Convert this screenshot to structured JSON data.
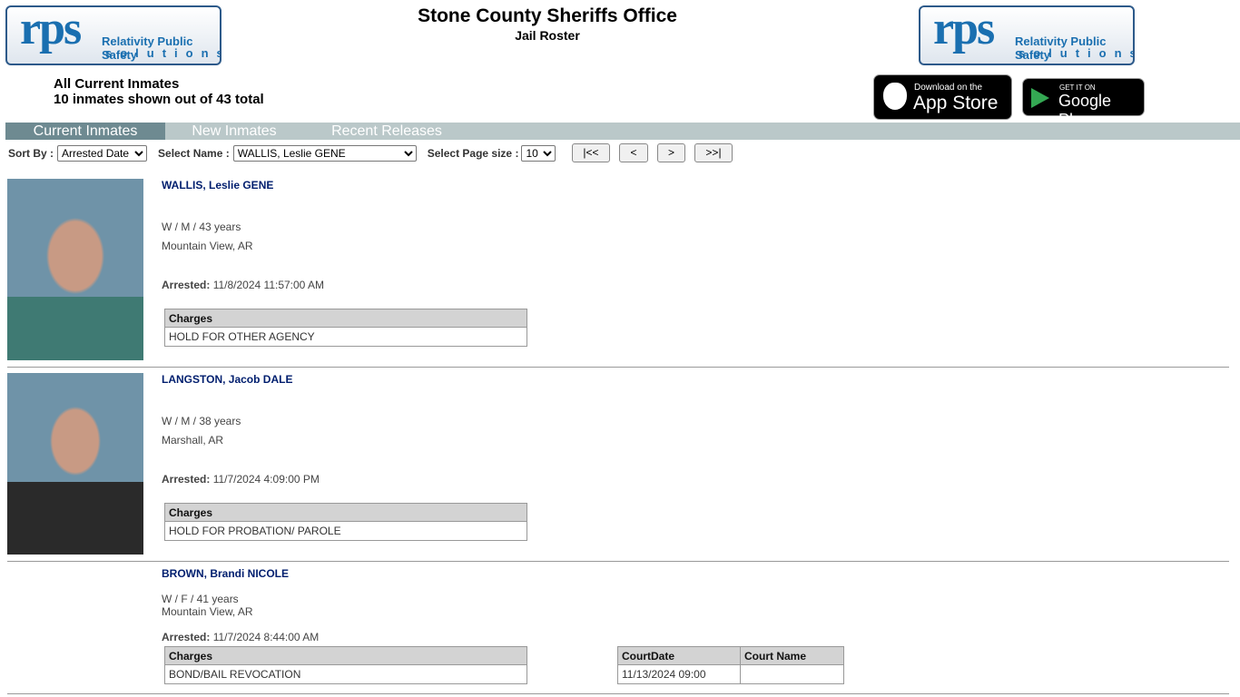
{
  "header": {
    "title": "Stone County Sheriffs Office",
    "subtitle": "Jail Roster",
    "logo_text": "rps",
    "logo_line1": "Relativity Public Safety",
    "logo_line2": "solutions"
  },
  "summary": {
    "line1": "All Current Inmates",
    "line2": "10 inmates shown out of 43 total"
  },
  "stores": {
    "apple_small": "Download on the",
    "apple_large": "App Store",
    "google_small": "GET IT ON",
    "google_large": "Google Play"
  },
  "tabs": [
    {
      "label": "Current Inmates",
      "active": true
    },
    {
      "label": "New Inmates"
    },
    {
      "label": "Recent Releases"
    }
  ],
  "controls": {
    "sort_label": "Sort By :",
    "sort_value": "Arrested Date",
    "name_label": "Select Name :",
    "name_value": "WALLIS, Leslie GENE",
    "page_size_label": "Select Page size :",
    "page_size_value": "10",
    "first": "|<<",
    "prev": "<",
    "next": ">",
    "last": ">>|"
  },
  "inmates": [
    {
      "name": "WALLIS, Leslie GENE",
      "demographics": "W / M / 43 years",
      "city": "Mountain View, AR",
      "arrested_label": "Arrested:",
      "arrested": "11/8/2024 11:57:00 AM",
      "charges_header": "Charges",
      "charges": [
        "HOLD FOR OTHER AGENCY"
      ]
    },
    {
      "name": "LANGSTON, Jacob DALE",
      "demographics": "W / M / 38 years",
      "city": "Marshall, AR",
      "arrested_label": "Arrested:",
      "arrested": "11/7/2024 4:09:00 PM",
      "charges_header": "Charges",
      "charges": [
        "HOLD FOR PROBATION/ PAROLE"
      ]
    },
    {
      "name": "BROWN, Brandi NICOLE",
      "demographics": "W / F / 41 years",
      "city": "Mountain View, AR",
      "arrested_label": "Arrested:",
      "arrested": "11/7/2024 8:44:00 AM",
      "charges_header": "Charges",
      "charges": [
        "BOND/BAIL REVOCATION"
      ],
      "court_headers": [
        "CourtDate",
        "Court Name"
      ],
      "court": [
        [
          "11/13/2024 09:00",
          ""
        ]
      ]
    }
  ]
}
